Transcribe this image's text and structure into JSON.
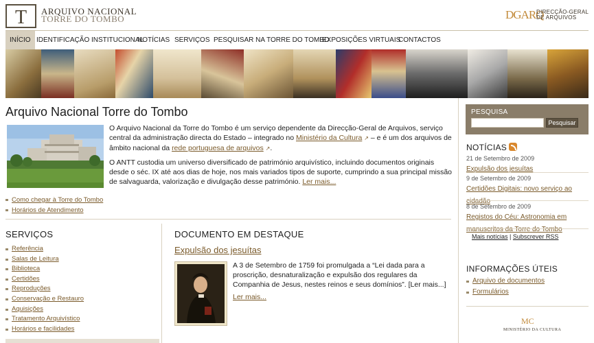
{
  "header": {
    "logo_letter": "T",
    "title_line1": "ARQUIVO NACIONAL",
    "title_line2": "TORRE DO TOMBO",
    "partner_logo": "DGARQ",
    "partner_line1": "DIRECÇÃO-GERAL",
    "partner_line2": "DE ARQUIVOS"
  },
  "nav": {
    "items": [
      {
        "label": "INÍCIO"
      },
      {
        "label": "IDENTIFICAÇÃO INSTITUCIONAL"
      },
      {
        "label": "NOTÍCIAS"
      },
      {
        "label": "SERVIÇOS"
      },
      {
        "label": "PESQUISAR NA TORRE DO TOMBO"
      },
      {
        "label": "EXPOSIÇÕES VIRTUAIS"
      },
      {
        "label": "CONTACTOS"
      }
    ]
  },
  "main": {
    "title": "Arquivo Nacional Torre do Tombo",
    "intro": {
      "p1_before": "O Arquivo Nacional da Torre do Tombo é um serviço dependente da Direcção-Geral de Arquivos, serviço central da administração directa do Estado – integrado no ",
      "p1_link1": "Ministério da Cultura",
      "p1_middle": " – e é um dos arquivos de âmbito nacional da ",
      "p1_link2": "rede portuguesa de arquivos",
      "p1_after": ".",
      "p2_text": "O ANTT custodia um universo diversificado de património arquivístico, incluindo documentos originais desde o séc. IX até aos dias de hoje, nos mais variados tipos de suporte, cumprindo a sua principal missão de salvaguarda, valorização e divulgação desse património. ",
      "p2_link": "Ler mais..."
    },
    "quicklinks": [
      {
        "label": "Como chegar à Torre do Tombo"
      },
      {
        "label": "Horários de Atendimento"
      }
    ]
  },
  "services": {
    "title": "SERVIÇOS",
    "items": [
      {
        "label": "Referência"
      },
      {
        "label": "Salas de Leitura"
      },
      {
        "label": "Biblioteca"
      },
      {
        "label": "Certidões"
      },
      {
        "label": "Reproduções"
      },
      {
        "label": "Conservação e Restauro"
      },
      {
        "label": "Aquisições"
      },
      {
        "label": "Tratamento Arquivístico"
      },
      {
        "label": "Horários e facilidades"
      }
    ]
  },
  "featured": {
    "title": "DOCUMENTO EM DESTAQUE",
    "link": "Expulsão dos jesuítas",
    "text": "A 3 de Setembro de 1759 foi promulgada a “Lei dada para a proscrição, desnaturalização e expulsão dos regulares da Companhia de Jesus, nestes reinos e seus domínios”. [Ler mais...]",
    "more": "Ler mais..."
  },
  "sidebar": {
    "search_label": "PESQUISA",
    "search_value": "",
    "search_button": "Pesquisar",
    "news_title": "NOTÍCIAS",
    "news": [
      {
        "date": "21 de Setembro de 2009",
        "title": "Expulsão dos jesuítas"
      },
      {
        "date": "9 de Setembro de 2009",
        "title": "Certidões Digitais: novo serviço ao cidadão"
      },
      {
        "date": "8 de Setembro de 2009",
        "title": "Registos do Céu: Astronomia em manuscritos da Torre do Tombo"
      }
    ],
    "more_news": "Mais notícias",
    "separator": "|",
    "rss": "Subscrever RSS",
    "info_title": "INFORMAÇÕES ÚTEIS",
    "info_items": [
      {
        "label": "Arquivo de documentos"
      },
      {
        "label": "Formulários"
      }
    ],
    "ministry_logo": "MC",
    "ministry_name": "MINISTÉRIO DA CULTURA"
  },
  "colors": {
    "accent": "#7a5a2a",
    "nav_active": "#d8d0bf",
    "search_bg": "#8a7d69"
  }
}
